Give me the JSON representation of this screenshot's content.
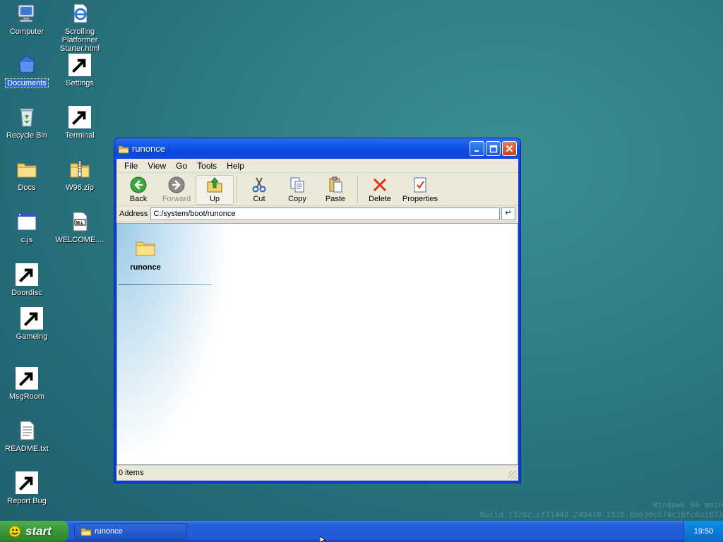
{
  "desktop": {
    "icons": [
      {
        "label": "Computer"
      },
      {
        "label": "Scrolling Platformer Starter.html"
      },
      {
        "label": "Documents"
      },
      {
        "label": "Settings"
      },
      {
        "label": "Recycle Bin"
      },
      {
        "label": "Terminal"
      },
      {
        "label": "Docs"
      },
      {
        "label": "W96.zip"
      },
      {
        "label": "c.js"
      },
      {
        "label": "WELCOME...."
      },
      {
        "label": "Doordisc"
      },
      {
        "label": "Gameing"
      },
      {
        "label": "MsgRoom"
      },
      {
        "label": "README.txt"
      },
      {
        "label": "Report Bug"
      }
    ],
    "terminal_glyph": "/#",
    "md_glyph": "M↓"
  },
  "window": {
    "title": "runonce",
    "menu": [
      "File",
      "View",
      "Go",
      "Tools",
      "Help"
    ],
    "toolbar": {
      "back": "Back",
      "forward": "Forward",
      "up": "Up",
      "cut": "Cut",
      "copy": "Copy",
      "paste": "Paste",
      "delete": "Delete",
      "properties": "Properties"
    },
    "address_label": "Address",
    "address_value": "C:/system/boot/runonce",
    "go_glyph": "↵",
    "folder_label": "runonce",
    "status": "0 items"
  },
  "watermark": {
    "line1": "Windows 96 main",
    "line2": "Build 13202.cf11448.240418-1828.0a630c874c18fc6a1873"
  },
  "taskbar": {
    "start_label": "start",
    "task_label": "runonce",
    "clock": "19:50"
  },
  "colors": {
    "titlebar": "#0a47d9",
    "taskbar": "#245edb",
    "start": "#3c9a3c",
    "desktop": "#2e7f86"
  }
}
